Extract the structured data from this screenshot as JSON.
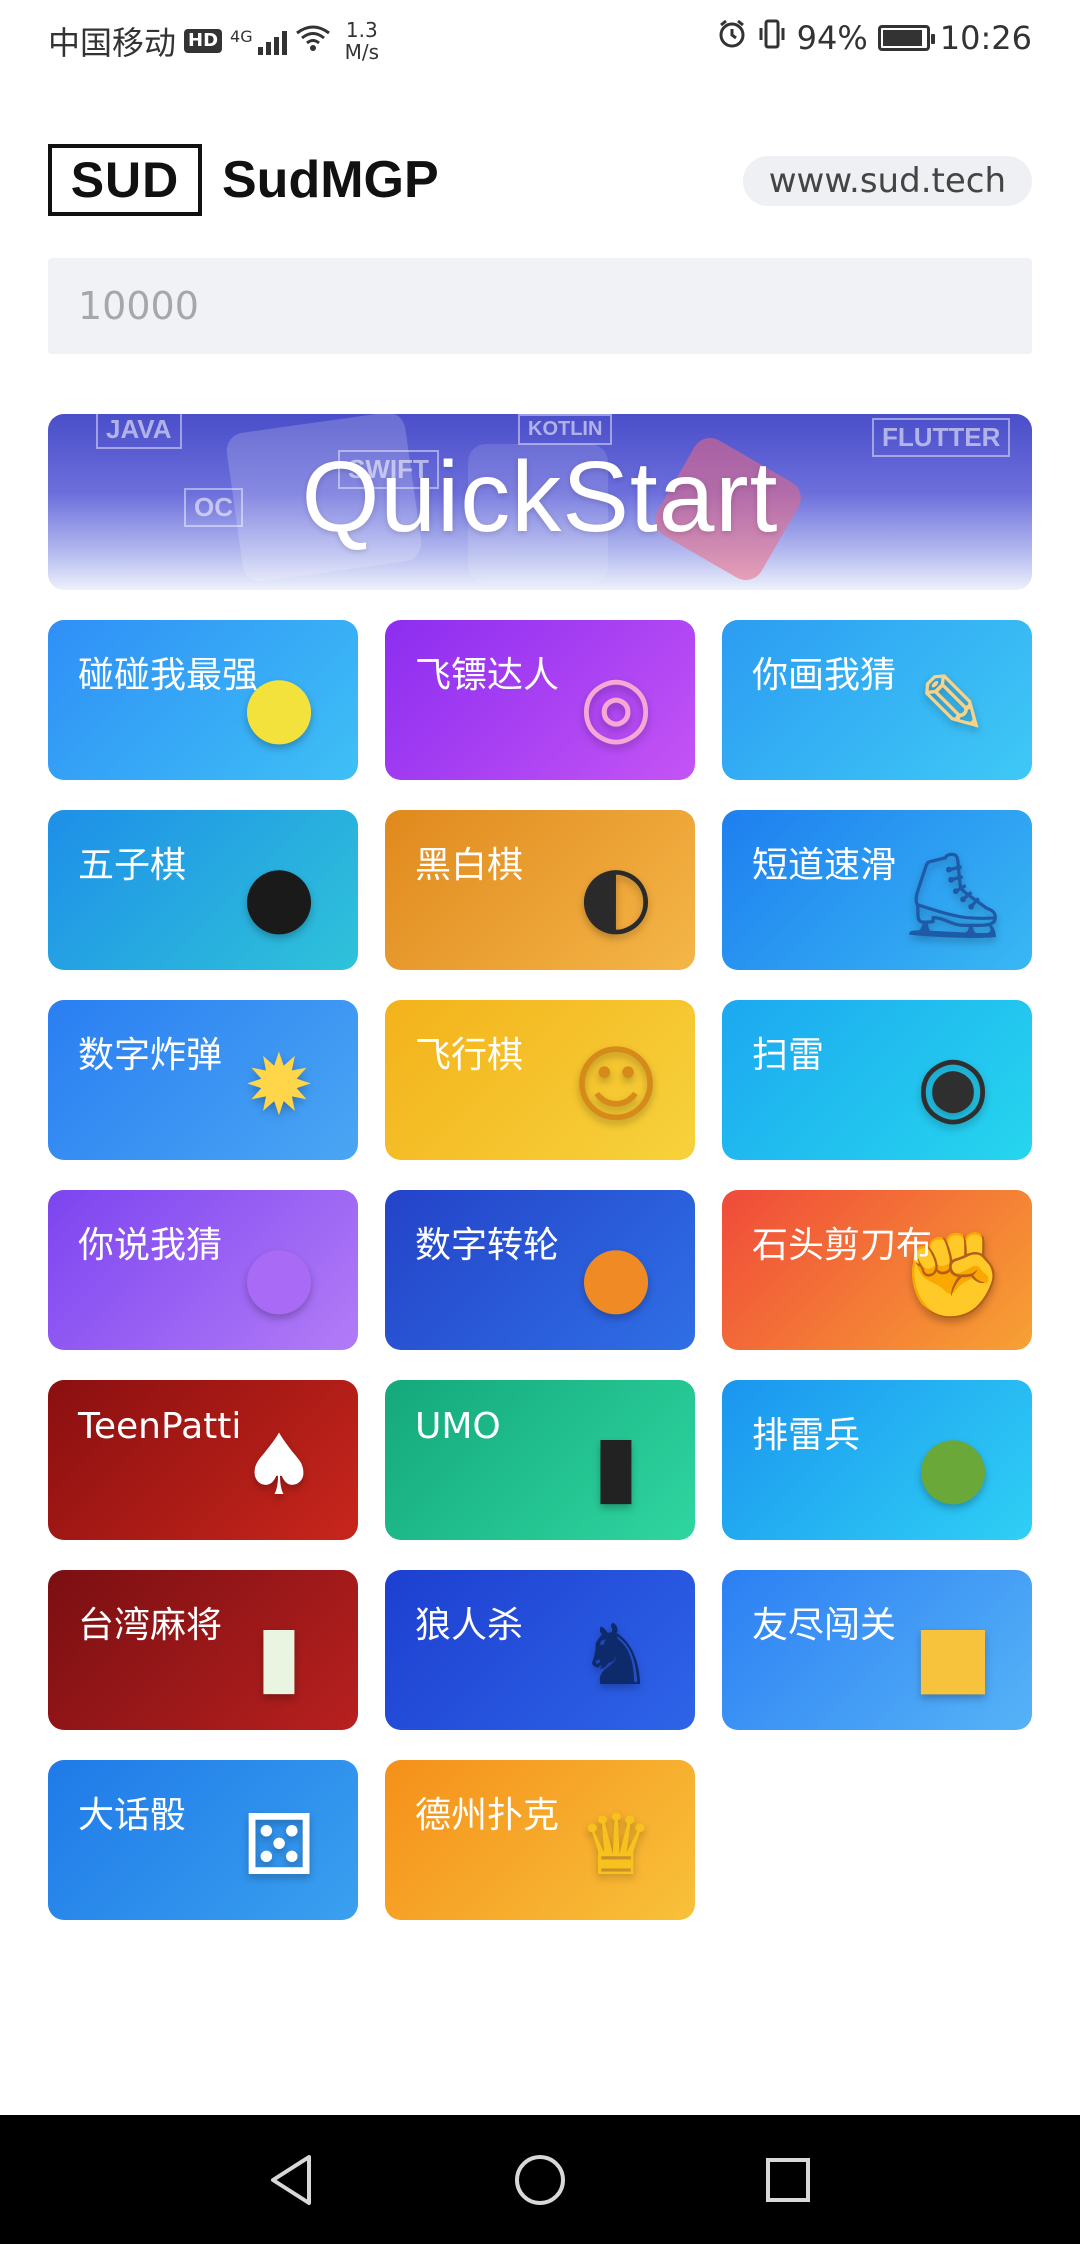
{
  "status_bar": {
    "carrier": "中国移动",
    "hd": "HD",
    "network": "4G",
    "speed_value": "1.3",
    "speed_unit": "M/s",
    "battery": "94%",
    "battery_level": 0.94,
    "time": "10:26"
  },
  "header": {
    "logo_text": "SUD",
    "title": "SudMGP",
    "url": "www.sud.tech"
  },
  "room_input": {
    "placeholder": "10000"
  },
  "banner": {
    "title": "QuickStart",
    "tags": [
      "JAVA",
      "KOTLIN",
      "SWIFT",
      "OC",
      "FLUTTER"
    ]
  },
  "games": [
    {
      "name": "碰碰我最强",
      "bg": "linear-gradient(135deg,#2f8ff7,#3ec0f5)",
      "icon": "ball-icon"
    },
    {
      "name": "飞镖达人",
      "bg": "linear-gradient(135deg,#8c2df0,#c454f5)",
      "icon": "dart-icon"
    },
    {
      "name": "你画我猜",
      "bg": "linear-gradient(135deg,#2c9cf2,#3fc9f6)",
      "icon": "pencil-icon"
    },
    {
      "name": "五子棋",
      "bg": "linear-gradient(135deg,#1e8fe8,#2fc3d9)",
      "icon": "gomoku-icon"
    },
    {
      "name": "黑白棋",
      "bg": "linear-gradient(135deg,#e0891d,#f5b648)",
      "icon": "reversi-icon"
    },
    {
      "name": "短道速滑",
      "bg": "linear-gradient(135deg,#1e7ff0,#39b8f3)",
      "icon": "skate-icon"
    },
    {
      "name": "数字炸弹",
      "bg": "linear-gradient(135deg,#2a7ef2,#4aa6f3)",
      "icon": "bomb-icon"
    },
    {
      "name": "飞行棋",
      "bg": "linear-gradient(135deg,#f3b21b,#f7d23c)",
      "icon": "ludo-icon"
    },
    {
      "name": "扫雷",
      "bg": "linear-gradient(135deg,#1ca8f0,#26d6ee)",
      "icon": "mine-icon"
    },
    {
      "name": "你说我猜",
      "bg": "linear-gradient(135deg,#7d44f0,#b27cf7)",
      "icon": "mic-icon"
    },
    {
      "name": "数字转轮",
      "bg": "linear-gradient(135deg,#2443c8,#2f6fe6)",
      "icon": "pumpkin-icon"
    },
    {
      "name": "石头剪刀布",
      "bg": "linear-gradient(135deg,#f04a3a,#f7a233)",
      "icon": "hand-icon"
    },
    {
      "name": "TeenPatti",
      "bg": "linear-gradient(135deg,#8a0f10,#c8261c)",
      "icon": "cards-icon"
    },
    {
      "name": "UMO",
      "bg": "linear-gradient(135deg,#14a87b,#2fd6a0)",
      "icon": "uno-icon"
    },
    {
      "name": "排雷兵",
      "bg": "linear-gradient(135deg,#1b95ef,#2fd0f5)",
      "icon": "soldier-icon"
    },
    {
      "name": "台湾麻将",
      "bg": "linear-gradient(135deg,#7a0f12,#b8201f)",
      "icon": "mahjong-icon"
    },
    {
      "name": "狼人杀",
      "bg": "linear-gradient(135deg,#1d3fd0,#2e64e8)",
      "icon": "wolf-icon"
    },
    {
      "name": "友尽闯关",
      "bg": "linear-gradient(135deg,#2c7ff4,#56b3f6)",
      "icon": "cube-icon"
    },
    {
      "name": "大话骰",
      "bg": "linear-gradient(135deg,#1f7ae8,#3aa0ef)",
      "icon": "dice-icon"
    },
    {
      "name": "德州扑克",
      "bg": "linear-gradient(135deg,#f5901a,#f8c13a)",
      "icon": "poker-icon"
    }
  ]
}
